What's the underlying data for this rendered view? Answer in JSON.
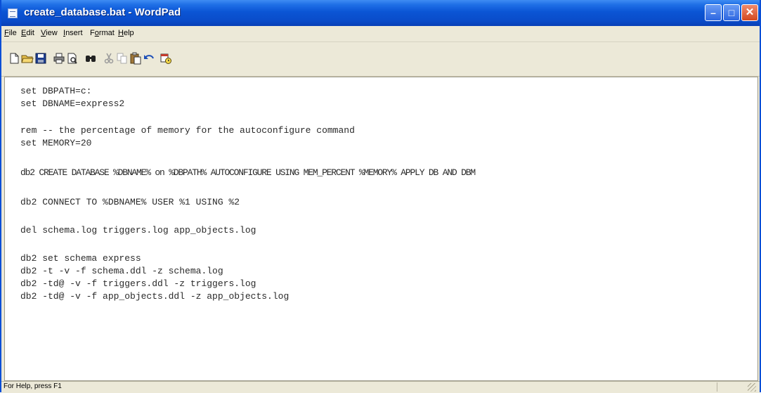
{
  "window": {
    "title": "create_database.bat - WordPad",
    "buttons": {
      "minimize": "–",
      "maximize": "□",
      "close": "✕"
    }
  },
  "menu": {
    "items": [
      {
        "mnemonic": "F",
        "rest": "ile"
      },
      {
        "mnemonic": "E",
        "rest": "dit"
      },
      {
        "mnemonic": "V",
        "rest": "iew"
      },
      {
        "mnemonic": "I",
        "rest": "nsert"
      },
      {
        "pre": "F",
        "mnemonic": "o",
        "rest": "rmat"
      },
      {
        "mnemonic": "H",
        "rest": "elp"
      }
    ]
  },
  "toolbar": {
    "icons": [
      "new-icon",
      "open-icon",
      "save-icon",
      "print-icon",
      "print-preview-icon",
      "find-icon",
      "cut-icon",
      "copy-icon",
      "paste-icon",
      "undo-icon",
      "insert-date-time-icon"
    ]
  },
  "editor": {
    "lines": [
      "set DBPATH=c:",
      "set DBNAME=express2",
      "rem -- the percentage of memory for the autoconfigure command",
      "set MEMORY=20",
      "db2 CREATE DATABASE %DBNAME% on %DBPATH% AUTOCONFIGURE USING MEM_PERCENT %MEMORY% APPLY DB AND DBM",
      "db2 CONNECT TO %DBNAME% USER %1 USING %2",
      "del schema.log triggers.log app_objects.log",
      "db2 set schema express",
      "db2 -t -v -f schema.ddl -z schema.log",
      "db2 -td@ -v -f triggers.ddl -z triggers.log",
      "db2 -td@ -v -f app_objects.ddl -z app_objects.log"
    ]
  },
  "status": {
    "text": "For Help, press F1"
  },
  "colors": {
    "titlebar": "#0a4cc9",
    "chrome": "#ece9d8",
    "close": "#d2481f"
  }
}
